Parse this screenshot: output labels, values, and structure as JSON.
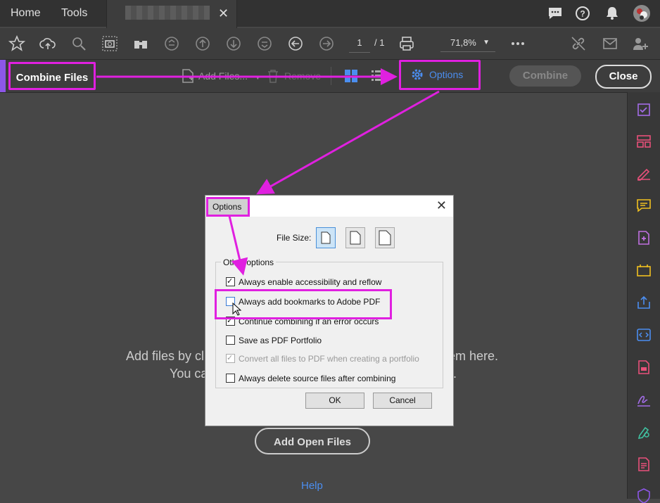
{
  "tabs": {
    "home": "Home",
    "tools": "Tools"
  },
  "toolbar": {
    "page_current": "1",
    "page_total": "/ 1",
    "zoom": "71,8%"
  },
  "combine_bar": {
    "title": "Combine Files",
    "add_files": "Add Files...",
    "remove": "Remove",
    "options": "Options",
    "combine": "Combine",
    "close": "Close"
  },
  "main": {
    "line1_left": "Add files by cl",
    "line1_right": "em here.",
    "line2_left": "You ca",
    "add_open_files": "Add Open Files",
    "help": "Help"
  },
  "dialog": {
    "title": "Options",
    "file_size_label": "File Size:",
    "group_label": "Other options",
    "options": [
      {
        "label": "Always enable accessibility and reflow",
        "checked": true,
        "enabled": true
      },
      {
        "label": "Always add bookmarks to Adobe PDF",
        "checked": false,
        "enabled": true
      },
      {
        "label": "Continue combining if an error occurs",
        "checked": true,
        "enabled": true
      },
      {
        "label": "Save as PDF Portfolio",
        "checked": false,
        "enabled": true
      },
      {
        "label": "Convert all files to PDF when creating a portfolio",
        "checked": true,
        "enabled": false
      },
      {
        "label": "Always delete source files after combining",
        "checked": false,
        "enabled": true
      }
    ],
    "ok": "OK",
    "cancel": "Cancel"
  },
  "colors": {
    "annotation": "#e020e0",
    "accent_blue": "#4b8ef0",
    "combine_accent": "#8d57e8"
  }
}
